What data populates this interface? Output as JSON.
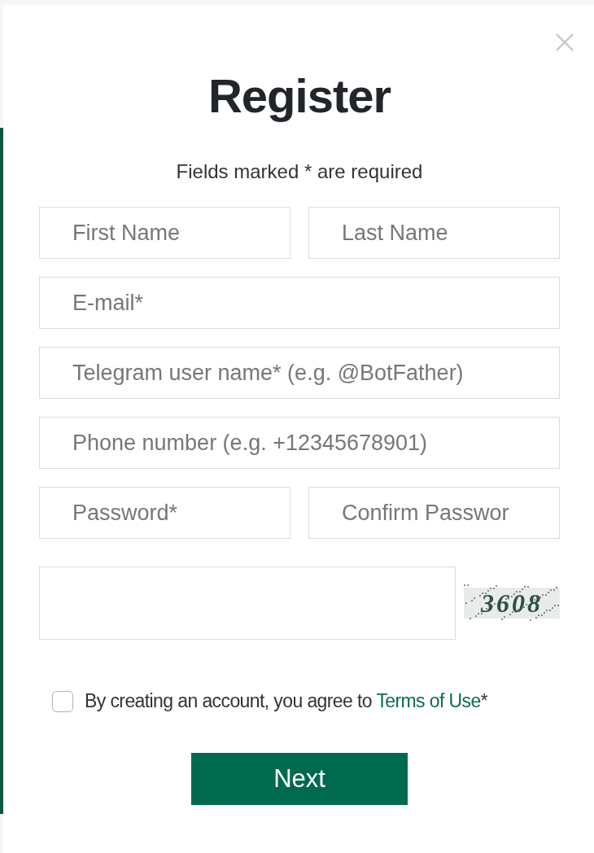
{
  "dialog": {
    "title": "Register",
    "subtitle": "Fields marked * are required"
  },
  "field_rows": [
    {
      "fields": [
        {
          "placeholder": "First Name"
        },
        {
          "placeholder": "Last Name"
        }
      ]
    },
    {
      "fields": [
        {
          "placeholder": "E-mail*"
        }
      ]
    },
    {
      "fields": [
        {
          "placeholder": "Telegram user name* (e.g. @BotFather)"
        }
      ]
    },
    {
      "fields": [
        {
          "placeholder": "Phone number (e.g. +12345678901)"
        }
      ]
    },
    {
      "fields": [
        {
          "placeholder": "Password*"
        },
        {
          "placeholder": "Confirm Passwor"
        }
      ]
    }
  ],
  "captcha": {
    "code": "3608"
  },
  "terms": {
    "checked": false,
    "text": "By creating an account, you agree to",
    "link": "Terms of Use",
    "suffix": "*"
  },
  "next_button": "Next"
}
